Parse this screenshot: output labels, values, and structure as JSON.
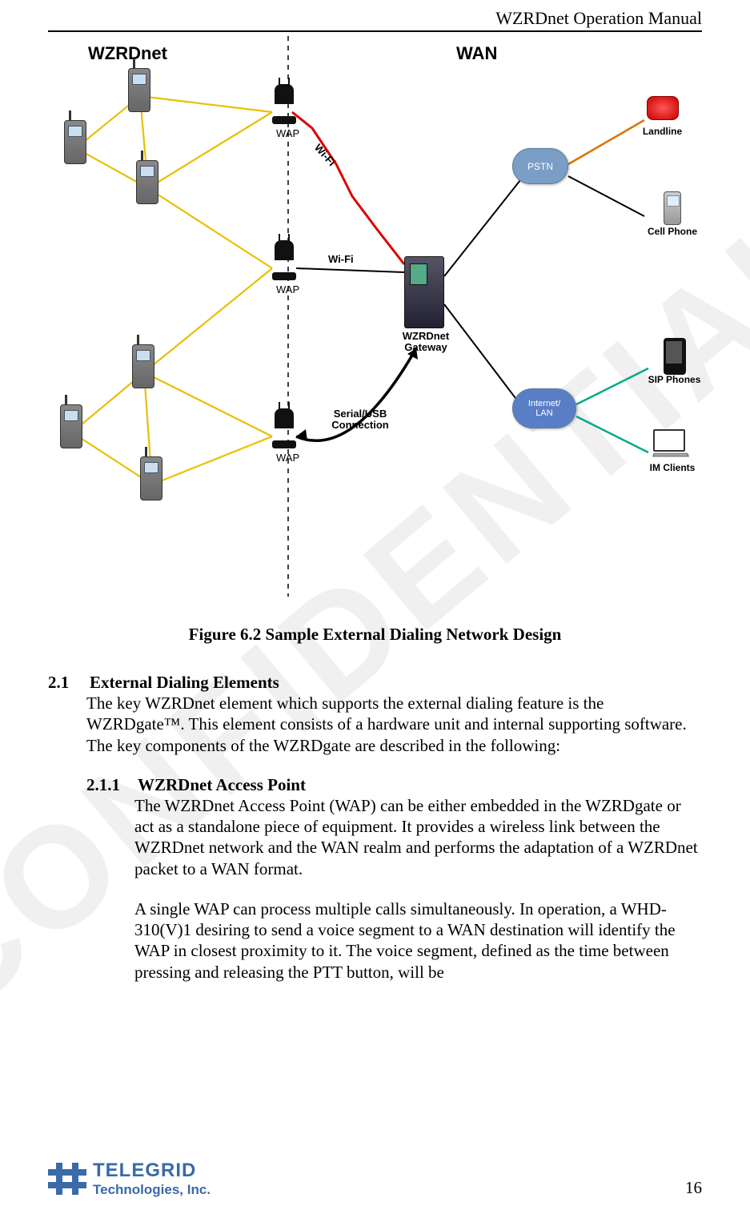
{
  "header": {
    "title": "WZRDnet Operation Manual"
  },
  "watermark": "CONFIDENTIAL",
  "diagram": {
    "titleLeft": "WZRDnet",
    "titleRight": "WAN",
    "labels": {
      "wap1": "WAP",
      "wap2": "WAP",
      "wap3": "WAP",
      "wifi1": "Wi-Fi",
      "wifi2": "Wi-Fi",
      "serial": "Serial/USB\nConnection",
      "gateway": "WZRDnet\nGateway",
      "pstn": "PSTN",
      "inet": "Internet/\nLAN",
      "landline": "Landline",
      "cellphone": "Cell Phone",
      "sip": "SIP Phones",
      "im": "IM Clients"
    },
    "caption": "Figure 6.2 Sample External Dialing Network Design"
  },
  "sections": {
    "s21": {
      "num": "2.1",
      "title": "External Dialing Elements",
      "body": "The key WZRDnet element which supports the external dialing feature is the WZRDgate™.  This element consists of a hardware unit and internal supporting software.  The key components of the WZRDgate are described in the following:"
    },
    "s211": {
      "num": "2.1.1",
      "title": "WZRDnet Access Point",
      "p1": "The WZRDnet Access Point (WAP) can be either embedded in the WZRDgate or act as a standalone piece of equipment.  It provides a wireless link between the WZRDnet network and the WAN realm and performs the adaptation of a WZRDnet packet to a WAN format.",
      "p2": "A single WAP can process multiple calls simultaneously.   In operation, a WHD-310(V)1 desiring to send a voice segment to a WAN destination will identify the WAP in closest proximity to it.  The voice segment, defined as the time between pressing and releasing the PTT button, will be"
    }
  },
  "footer": {
    "company1": "TELEGRID",
    "company2": "Technologies, Inc.",
    "page": "16"
  }
}
